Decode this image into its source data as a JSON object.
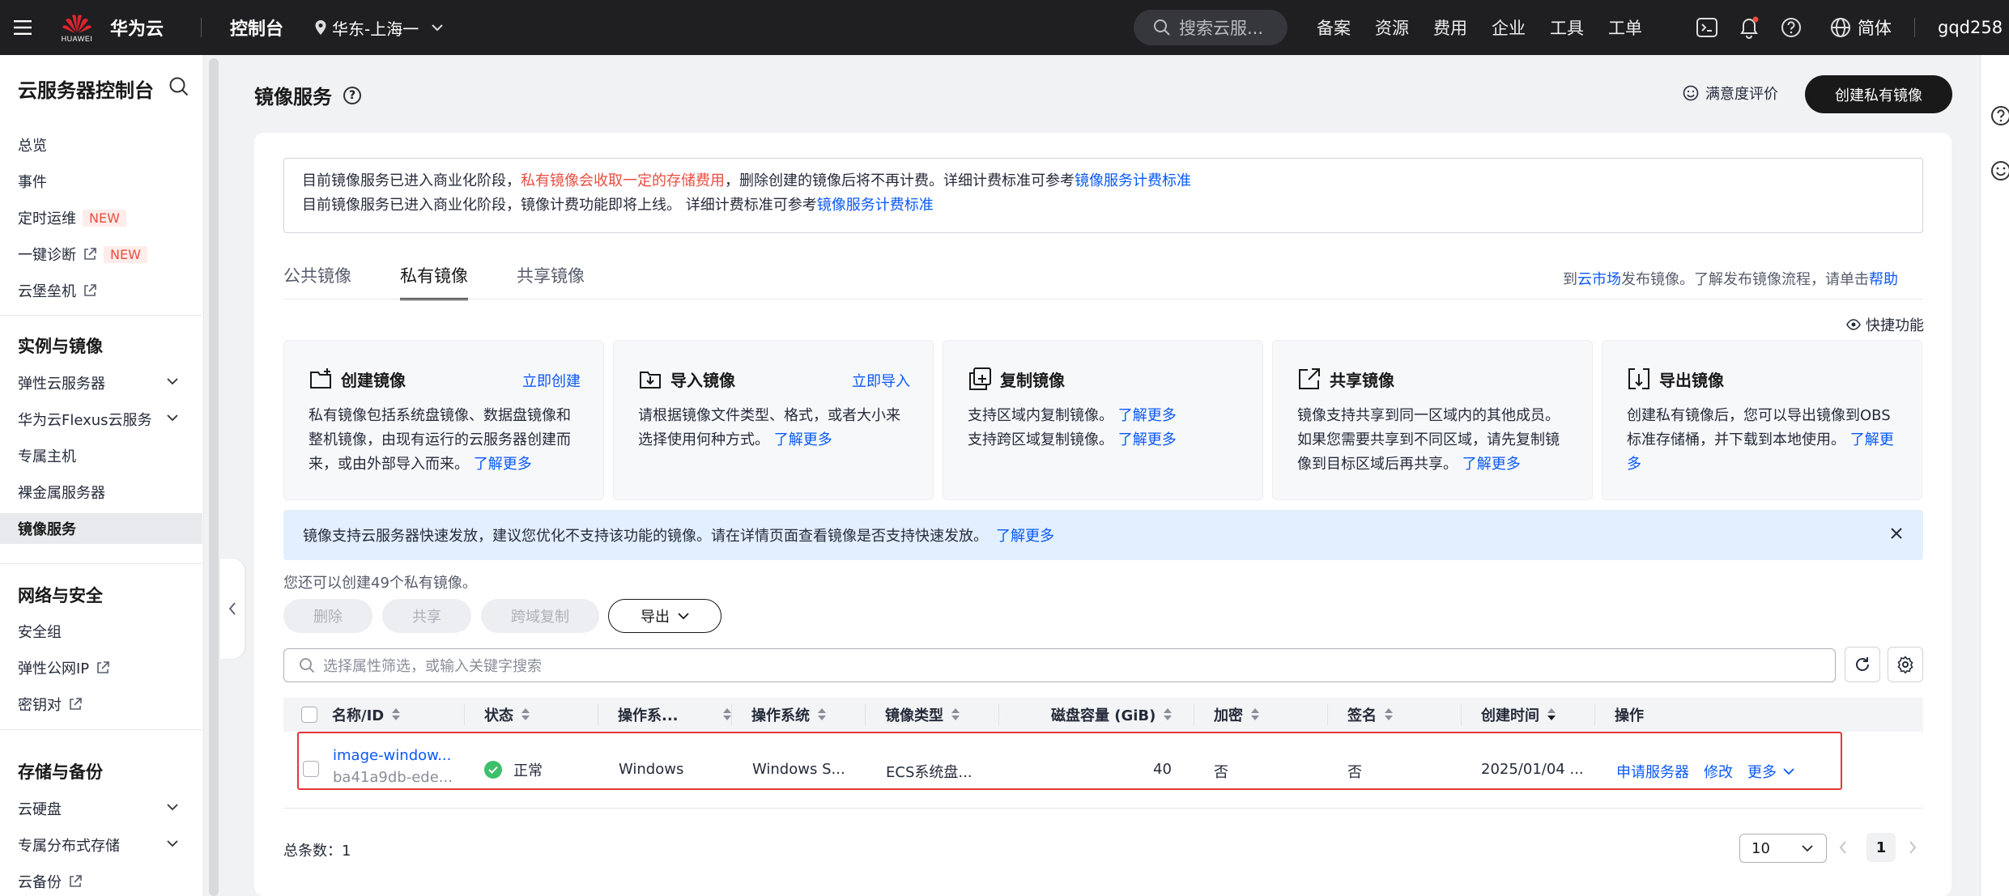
{
  "topbar": {
    "logo_text": "华为云",
    "logo_sub": "HUAWEI",
    "console": "控制台",
    "region": "华东-上海一",
    "search_placeholder": "搜索云服...",
    "nav": [
      "备案",
      "资源",
      "费用",
      "企业",
      "工具",
      "工单"
    ],
    "lang": "简体",
    "user": "gqd258"
  },
  "sidebar": {
    "title": "云服务器控制台",
    "items_top": [
      {
        "label": "总览"
      },
      {
        "label": "事件"
      },
      {
        "label": "定时运维",
        "badge": "NEW"
      },
      {
        "label": "一键诊断",
        "badge": "NEW"
      },
      {
        "label": "云堡垒机"
      }
    ],
    "section1": {
      "title": "实例与镜像",
      "items": [
        "弹性云服务器",
        "华为云Flexus云服务",
        "专属主机",
        "裸金属服务器",
        "镜像服务"
      ]
    },
    "section2": {
      "title": "网络与安全",
      "items": [
        "安全组",
        "弹性公网IP",
        "密钥对"
      ]
    },
    "section3": {
      "title": "存储与备份",
      "items": [
        "云硬盘",
        "专属分布式存储",
        "云备份"
      ]
    }
  },
  "page": {
    "title": "镜像服务",
    "satisfaction": "满意度评价",
    "create_button": "创建私有镜像"
  },
  "notice": {
    "line1_a": "目前镜像服务已进入商业化阶段，",
    "line1_red": "私有镜像会收取一定的存储费用",
    "line1_b": "，删除创建的镜像后将不再计费。详细计费标准可参考",
    "line1_link": "镜像服务计费标准",
    "line2_a": "目前镜像服务已进入商业化阶段，镜像计费功能即将上线。 详细计费标准可参考",
    "line2_link": "镜像服务计费标准"
  },
  "tabs": [
    "公共镜像",
    "私有镜像",
    "共享镜像"
  ],
  "tab_right": {
    "a": "到",
    "link1": "云市场",
    "b": "发布镜像。了解发布镜像流程，请单击",
    "link2": "帮助"
  },
  "quick": "快捷功能",
  "features": [
    {
      "title": "创建镜像",
      "action": "立即创建",
      "body": "私有镜像包括系统盘镜像、数据盘镜像和整机镜像，由现有运行的云服务器创建而来，或由外部导入而来。",
      "more": "了解更多",
      "icon": "create-image-icon"
    },
    {
      "title": "导入镜像",
      "action": "立即导入",
      "body": "请根据镜像文件类型、格式，或者大小来选择使用何种方式。",
      "more": "了解更多",
      "icon": "import-image-icon"
    },
    {
      "title": "复制镜像",
      "action": "",
      "body1": "支持区域内复制镜像。",
      "more1": "了解更多",
      "body2": "支持跨区域复制镜像。",
      "more2": "了解更多",
      "icon": "copy-image-icon"
    },
    {
      "title": "共享镜像",
      "action": "",
      "body": "镜像支持共享到同一区域内的其他成员。如果您需要共享到不同区域，请先复制镜像到目标区域后再共享。",
      "more": "了解更多",
      "icon": "share-image-icon"
    },
    {
      "title": "导出镜像",
      "action": "",
      "body": "创建私有镜像后，您可以导出镜像到OBS标准存储桶，并下载到本地使用。",
      "more": "了解更多",
      "icon": "export-image-icon"
    }
  ],
  "info_bar": {
    "text": "镜像支持云服务器快速发放，建议您优化不支持该功能的镜像。请在详情页面查看镜像是否支持快速发放。",
    "link": "了解更多"
  },
  "quota": "您还可以创建49个私有镜像。",
  "buttons": {
    "delete": "删除",
    "share": "共享",
    "cross_copy": "跨域复制",
    "export": "导出"
  },
  "filter_placeholder": "选择属性筛选，或输入关键字搜索",
  "table": {
    "columns": [
      "名称/ID",
      "状态",
      "操作系...",
      "操作系统",
      "镜像类型",
      "磁盘容量 (GiB)",
      "加密",
      "签名",
      "创建时间",
      "操作"
    ],
    "rows": [
      {
        "name": "image-window...",
        "id": "ba41a9db-ede...",
        "status": "正常",
        "os_type": "Windows",
        "os": "Windows S...",
        "image_type": "ECS系统盘...",
        "disk": "40",
        "encrypted": "否",
        "signed": "否",
        "created": "2025/01/04 ...",
        "actions": [
          "申请服务器",
          "修改",
          "更多"
        ]
      }
    ]
  },
  "footer": {
    "total_label": "总条数：",
    "total": "1",
    "page_size": "10",
    "page": "1"
  }
}
